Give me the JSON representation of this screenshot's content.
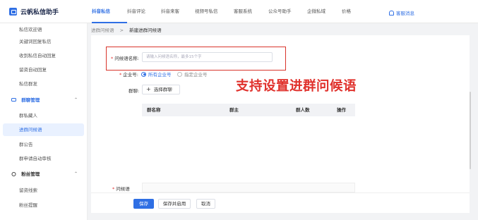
{
  "header": {
    "app_name": "云帆私信助手",
    "nav": [
      "抖音私信",
      "抖音评论",
      "抖音来客",
      "视频号私信",
      "客服系统",
      "公众号助手",
      "企微私域",
      "价格"
    ],
    "service_label": "客服消息"
  },
  "sidebar": {
    "items_top": [
      "私信欢迎语",
      "关键词回复私信",
      "收到私信自动回复",
      "留资自动回复",
      "私信群发"
    ],
    "group_management": "群聊管理",
    "group_items": [
      "群私藏人",
      "进群问候语",
      "群公告",
      "群申请自动审核"
    ],
    "fans_management": "粉丝管理",
    "fans_items": [
      "留资线索",
      "粉丝提醒"
    ]
  },
  "breadcrumb": {
    "parent": "进群问候语",
    "separator": ">",
    "current": "新建进群问候语"
  },
  "form": {
    "name_label": "问候语名称:",
    "name_placeholder": "请输入问候语名称，最多15个字",
    "enterprise_label": "企业号:",
    "enterprise_options": [
      "所有企业号",
      "指定企业号"
    ],
    "group_label": "群聊:",
    "select_group_button": "选择群聊",
    "table_headers": [
      "群名称",
      "群主",
      "群人数",
      "操作"
    ],
    "greeting_label": "问候语"
  },
  "annotation_text": "支持设置进群问候语",
  "footer": {
    "save": "保存",
    "save_enable": "保存并启用",
    "cancel": "取消"
  },
  "colors": {
    "accent": "#2f6fe4",
    "highlight_border": "#d9342b",
    "annotation": "#e0312c",
    "required": "#e03131"
  }
}
